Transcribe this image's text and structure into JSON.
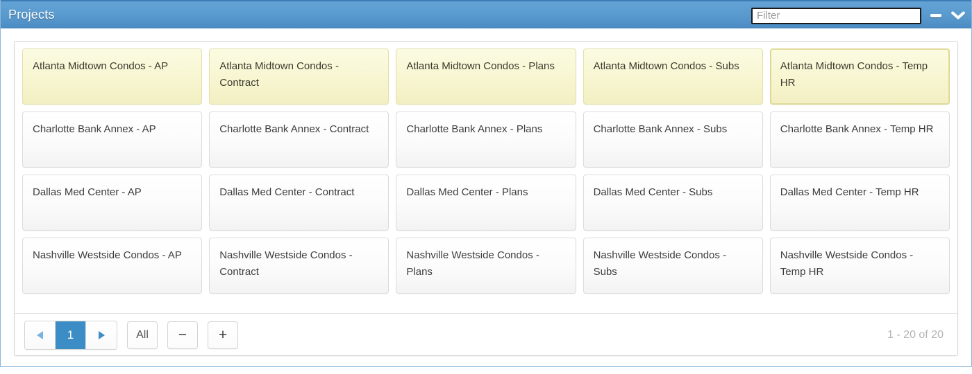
{
  "window": {
    "title": "Projects",
    "minimize_icon": "minus-icon",
    "collapse_icon": "chevron-down-icon"
  },
  "filter": {
    "value": "",
    "placeholder": "Filter"
  },
  "cards": [
    {
      "label": "Atlanta Midtown Condos - AP",
      "selected": true,
      "focused": false
    },
    {
      "label": "Atlanta Midtown Condos - Contract",
      "selected": true,
      "focused": false
    },
    {
      "label": "Atlanta Midtown Condos - Plans",
      "selected": true,
      "focused": false
    },
    {
      "label": "Atlanta Midtown Condos - Subs",
      "selected": true,
      "focused": false
    },
    {
      "label": "Atlanta Midtown Condos - Temp HR",
      "selected": true,
      "focused": true
    },
    {
      "label": "Charlotte Bank Annex - AP",
      "selected": false,
      "focused": false
    },
    {
      "label": "Charlotte Bank Annex - Contract",
      "selected": false,
      "focused": false
    },
    {
      "label": "Charlotte Bank Annex - Plans",
      "selected": false,
      "focused": false
    },
    {
      "label": "Charlotte Bank Annex - Subs",
      "selected": false,
      "focused": false
    },
    {
      "label": "Charlotte Bank Annex - Temp HR",
      "selected": false,
      "focused": false
    },
    {
      "label": "Dallas Med Center - AP",
      "selected": false,
      "focused": false
    },
    {
      "label": "Dallas Med Center - Contract",
      "selected": false,
      "focused": false
    },
    {
      "label": "Dallas Med Center - Plans",
      "selected": false,
      "focused": false
    },
    {
      "label": "Dallas Med Center - Subs",
      "selected": false,
      "focused": false
    },
    {
      "label": "Dallas Med Center - Temp HR",
      "selected": false,
      "focused": false
    },
    {
      "label": "Nashville Westside Condos - AP",
      "selected": false,
      "focused": false
    },
    {
      "label": "Nashville Westside Condos - Contract",
      "selected": false,
      "focused": false
    },
    {
      "label": "Nashville Westside Condos - Plans",
      "selected": false,
      "focused": false
    },
    {
      "label": "Nashville Westside Condos - Subs",
      "selected": false,
      "focused": false
    },
    {
      "label": "Nashville Westside Condos - Temp HR",
      "selected": false,
      "focused": false
    }
  ],
  "pager": {
    "prev_icon": "triangle-left-icon",
    "page_label": "1",
    "next_icon": "triangle-right-icon",
    "all_label": "All",
    "decrease_label": "−",
    "increase_label": "+",
    "status": "1 - 20 of 20"
  },
  "colors": {
    "titlebar_top": "#63a2d4",
    "titlebar_bottom": "#4c8cc4",
    "accent": "#3c8dc5",
    "selected_card": "#f7f5cf",
    "panel_border": "#8ab4dc",
    "status_text": "#b4b4b4"
  }
}
